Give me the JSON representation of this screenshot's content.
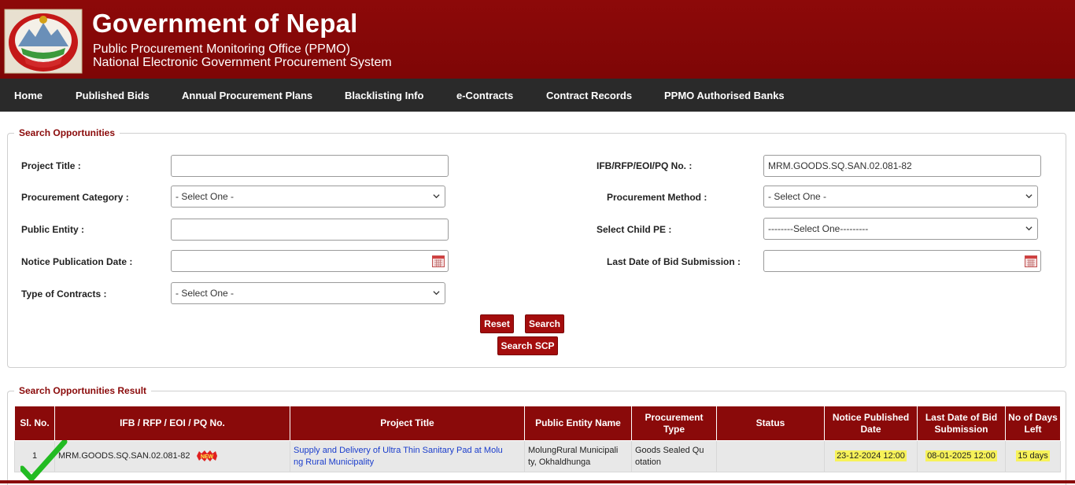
{
  "header": {
    "title": "Government of Nepal",
    "subtitle1": "Public Procurement Monitoring Office (PPMO)",
    "subtitle2": "National Electronic Government Procurement System"
  },
  "nav": {
    "items": [
      "Home",
      "Published Bids",
      "Annual Procurement Plans",
      "Blacklisting Info",
      "e-Contracts",
      "Contract Records",
      "PPMO Authorised Banks"
    ]
  },
  "search": {
    "legend": "Search Opportunities",
    "project_title_label": "Project Title :",
    "project_title_value": "",
    "ifb_label": "IFB/RFP/EOI/PQ No. :",
    "ifb_value": "MRM.GOODS.SQ.SAN.02.081-82",
    "proc_category_label": "Procurement Category :",
    "proc_category_value": "- Select One -",
    "proc_method_label": "Procurement Method :",
    "proc_method_value": "- Select One -",
    "public_entity_label": "Public Entity :",
    "public_entity_value": "",
    "child_pe_label": "Select Child PE :",
    "child_pe_value": "--------Select One---------",
    "notice_date_label": "Notice Publication Date :",
    "notice_date_value": "",
    "last_date_label": "Last Date of Bid Submission :",
    "last_date_value": "",
    "contract_type_label": "Type of Contracts :",
    "contract_type_value": "- Select One -",
    "reset_label": "Reset",
    "search_label": "Search",
    "search_scp_label": "Search SCP"
  },
  "results": {
    "legend": "Search Opportunities Result",
    "columns": [
      "Sl. No.",
      "IFB / RFP / EOI / PQ No.",
      "Project Title",
      "Public Entity Name",
      "Procurement Type",
      "Status",
      "Notice Published Date",
      "Last Date of Bid Submission",
      "No of Days Left"
    ],
    "rows": [
      {
        "sl": "1",
        "ifb": "MRM.GOODS.SQ.SAN.02.081-82",
        "badge": "NEW",
        "project_title_line1": "Supply and Delivery of Ultra Thin Sanitary Pad at Molu",
        "project_title_line2": "ng Rural Municipality",
        "entity_line1": "MolungRural Municipali",
        "entity_line2": "ty, Okhaldhunga",
        "type_line1": "Goods  Sealed Qu",
        "type_line2": "otation",
        "status": "",
        "notice_date": "23-12-2024 12:00",
        "last_date": "08-01-2025 12:00",
        "days_left": "15 days"
      }
    ]
  },
  "colors": {
    "header_red": "#8d0909",
    "nav_dark": "#2a2a2a",
    "accent_red": "#8a0a0a",
    "highlight": "#f7f259",
    "link_blue": "#1a3dcc"
  }
}
